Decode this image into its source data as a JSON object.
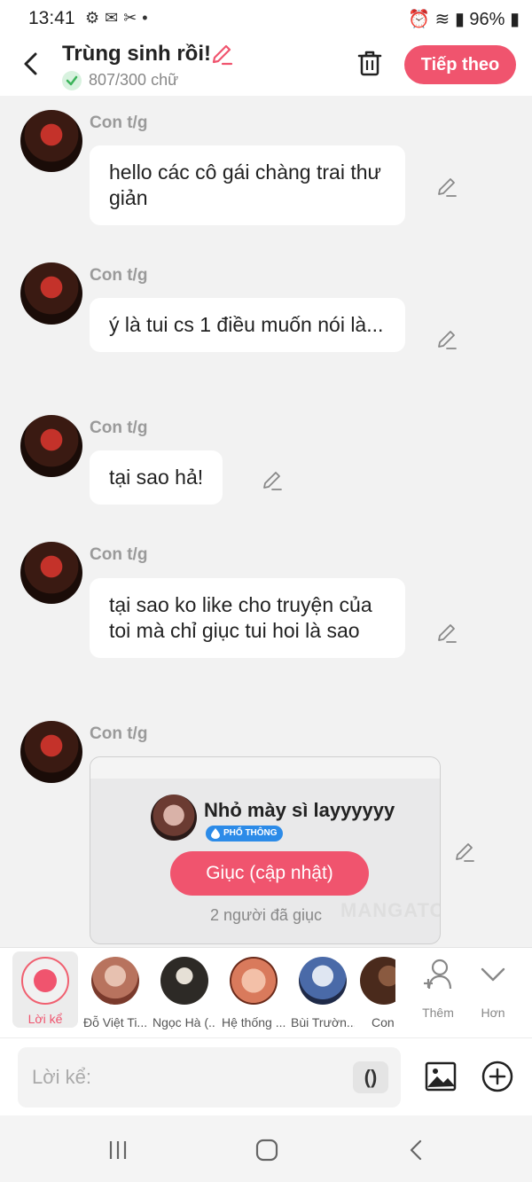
{
  "status_bar": {
    "time": "13:41",
    "battery": "96%"
  },
  "header": {
    "title": "Trùng sinh rồi!",
    "word_count": "807/300 chữ",
    "next_label": "Tiếp theo"
  },
  "messages": [
    {
      "sender": "Con t/g",
      "text": "hello các cô gái chàng trai thư giản"
    },
    {
      "sender": "Con t/g",
      "text": "ý là tui cs 1 điều muốn nói là..."
    },
    {
      "sender": "Con t/g",
      "text": "tại sao hả!"
    },
    {
      "sender": "Con t/g",
      "text": "tại sao ko like cho truyện của toi mà chỉ giục tui hoi là sao"
    },
    {
      "sender": "Con t/g",
      "text": ""
    }
  ],
  "reminder_card": {
    "name": "Nhỏ mày sì layyyyyy",
    "badge": "PHỔ THÔNG",
    "button_label": "Giục (cập nhật)",
    "count_text": "2 người đã giục",
    "watermark": "MANGATO"
  },
  "characters": {
    "narrator_label": "Lời kể",
    "items": [
      {
        "label": "Đỗ Việt Ti...",
        "color": "#b8735e"
      },
      {
        "label": "Ngọc Hà (...",
        "color": "#2d2a26"
      },
      {
        "label": "Hệ thống ...",
        "color": "#d97a5c"
      },
      {
        "label": "Bùi Trườn...",
        "color": "#4a6aa8"
      },
      {
        "label": "Con",
        "color": "#4a2a1c"
      }
    ],
    "add_label": "Thêm",
    "more_label": "Hơn"
  },
  "composer": {
    "placeholder": "Lời kể:",
    "paren_label": "()"
  },
  "colors": {
    "accent": "#f0546e",
    "background": "#f2f2f2"
  }
}
